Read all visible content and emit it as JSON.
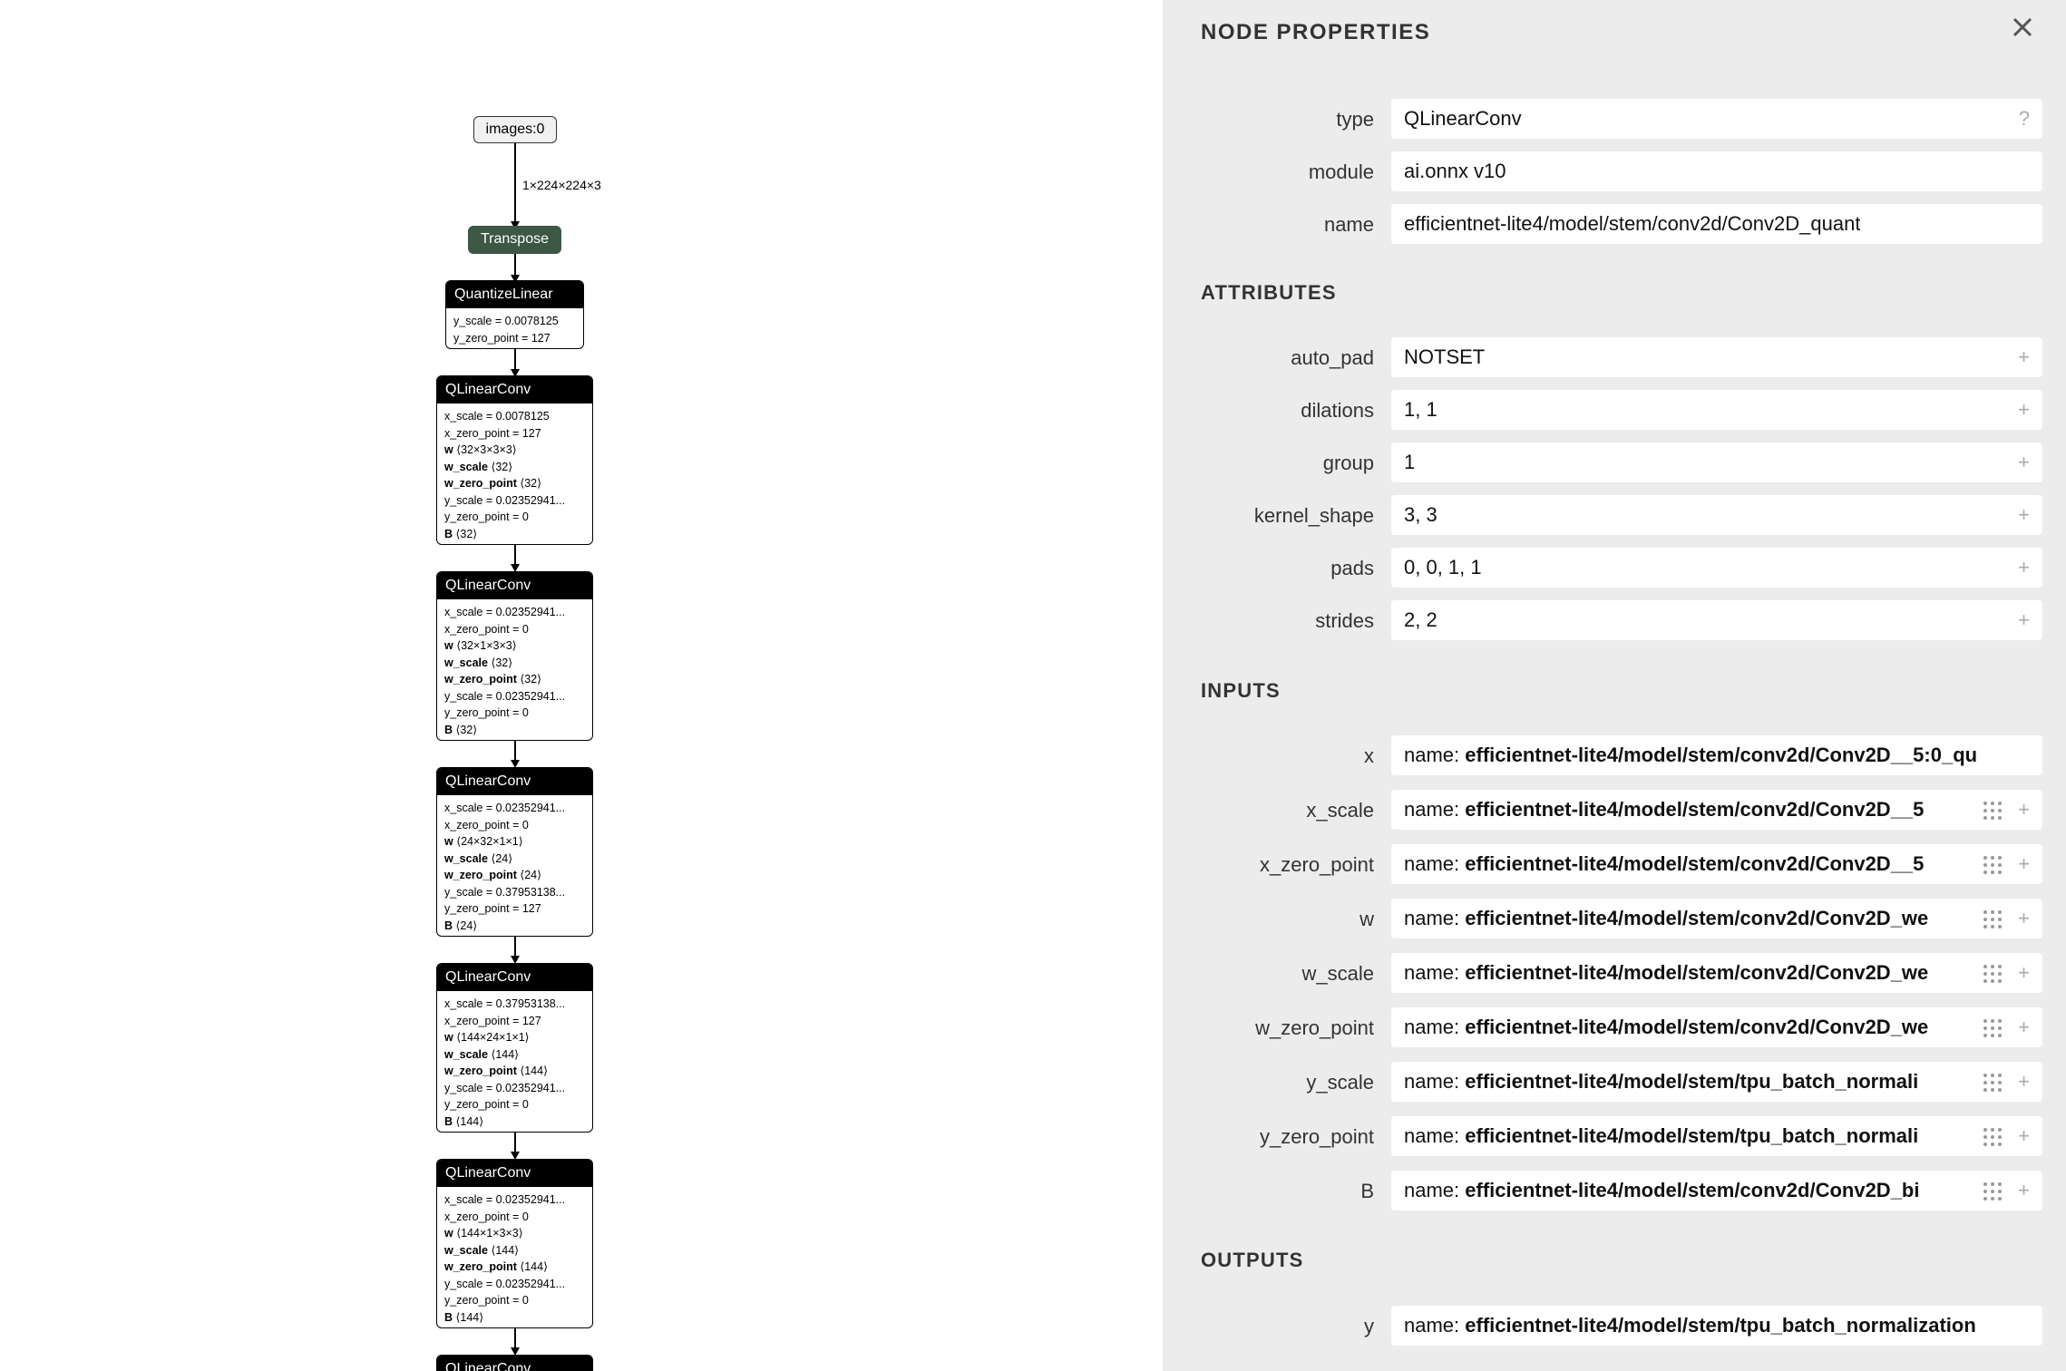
{
  "graph": {
    "input_node": "images:0",
    "input_edge_label": "1×224×224×3",
    "transpose_node": "Transpose",
    "quantize_node": {
      "title": "QuantizeLinear",
      "attrs": [
        {
          "k": "y_scale",
          "v": " = 0.0078125"
        },
        {
          "k": "y_zero_point",
          "v": " = 127"
        }
      ]
    },
    "conv_nodes": [
      {
        "title": "QLinearConv",
        "attrs": [
          {
            "k": "x_scale",
            "v": " = 0.0078125",
            "bold": false
          },
          {
            "k": "x_zero_point",
            "v": " = 127",
            "bold": false
          },
          {
            "k": "w",
            "v": " ⟨32×3×3×3⟩",
            "bold": true
          },
          {
            "k": "w_scale",
            "v": " ⟨32⟩",
            "bold": true
          },
          {
            "k": "w_zero_point",
            "v": " ⟨32⟩",
            "bold": true
          },
          {
            "k": "y_scale",
            "v": " = 0.02352941...",
            "bold": false
          },
          {
            "k": "y_zero_point",
            "v": " = 0",
            "bold": false
          },
          {
            "k": "B",
            "v": " ⟨32⟩",
            "bold": true
          }
        ]
      },
      {
        "title": "QLinearConv",
        "attrs": [
          {
            "k": "x_scale",
            "v": " = 0.02352941...",
            "bold": false
          },
          {
            "k": "x_zero_point",
            "v": " = 0",
            "bold": false
          },
          {
            "k": "w",
            "v": " ⟨32×1×3×3⟩",
            "bold": true
          },
          {
            "k": "w_scale",
            "v": " ⟨32⟩",
            "bold": true
          },
          {
            "k": "w_zero_point",
            "v": " ⟨32⟩",
            "bold": true
          },
          {
            "k": "y_scale",
            "v": " = 0.02352941...",
            "bold": false
          },
          {
            "k": "y_zero_point",
            "v": " = 0",
            "bold": false
          },
          {
            "k": "B",
            "v": " ⟨32⟩",
            "bold": true
          }
        ]
      },
      {
        "title": "QLinearConv",
        "attrs": [
          {
            "k": "x_scale",
            "v": " = 0.02352941...",
            "bold": false
          },
          {
            "k": "x_zero_point",
            "v": " = 0",
            "bold": false
          },
          {
            "k": "w",
            "v": " ⟨24×32×1×1⟩",
            "bold": true
          },
          {
            "k": "w_scale",
            "v": " ⟨24⟩",
            "bold": true
          },
          {
            "k": "w_zero_point",
            "v": " ⟨24⟩",
            "bold": true
          },
          {
            "k": "y_scale",
            "v": " = 0.37953138...",
            "bold": false
          },
          {
            "k": "y_zero_point",
            "v": " = 127",
            "bold": false
          },
          {
            "k": "B",
            "v": " ⟨24⟩",
            "bold": true
          }
        ]
      },
      {
        "title": "QLinearConv",
        "attrs": [
          {
            "k": "x_scale",
            "v": " = 0.37953138...",
            "bold": false
          },
          {
            "k": "x_zero_point",
            "v": " = 127",
            "bold": false
          },
          {
            "k": "w",
            "v": " ⟨144×24×1×1⟩",
            "bold": true
          },
          {
            "k": "w_scale",
            "v": " ⟨144⟩",
            "bold": true
          },
          {
            "k": "w_zero_point",
            "v": " ⟨144⟩",
            "bold": true
          },
          {
            "k": "y_scale",
            "v": " = 0.02352941...",
            "bold": false
          },
          {
            "k": "y_zero_point",
            "v": " = 0",
            "bold": false
          },
          {
            "k": "B",
            "v": " ⟨144⟩",
            "bold": true
          }
        ]
      },
      {
        "title": "QLinearConv",
        "attrs": [
          {
            "k": "x_scale",
            "v": " = 0.02352941...",
            "bold": false
          },
          {
            "k": "x_zero_point",
            "v": " = 0",
            "bold": false
          },
          {
            "k": "w",
            "v": " ⟨144×1×3×3⟩",
            "bold": true
          },
          {
            "k": "w_scale",
            "v": " ⟨144⟩",
            "bold": true
          },
          {
            "k": "w_zero_point",
            "v": " ⟨144⟩",
            "bold": true
          },
          {
            "k": "y_scale",
            "v": " = 0.02352941...",
            "bold": false
          },
          {
            "k": "y_zero_point",
            "v": " = 0",
            "bold": false
          },
          {
            "k": "B",
            "v": " ⟨144⟩",
            "bold": true
          }
        ]
      },
      {
        "title": "QLinearConv",
        "attrs": []
      }
    ]
  },
  "panel": {
    "title": "NODE PROPERTIES",
    "close_icon": "close-icon",
    "node_props": [
      {
        "label": "type",
        "value": "QLinearConv",
        "button": "?"
      },
      {
        "label": "module",
        "value": "ai.onnx v10",
        "button": ""
      },
      {
        "label": "name",
        "value": "efficientnet-lite4/model/stem/conv2d/Conv2D_quant",
        "button": ""
      }
    ],
    "attributes_title": "ATTRIBUTES",
    "attributes": [
      {
        "label": "auto_pad",
        "value": "NOTSET",
        "button": "+"
      },
      {
        "label": "dilations",
        "value": "1, 1",
        "button": "+"
      },
      {
        "label": "group",
        "value": "1",
        "button": "+"
      },
      {
        "label": "kernel_shape",
        "value": "3, 3",
        "button": "+"
      },
      {
        "label": "pads",
        "value": "0, 0, 1, 1",
        "button": "+"
      },
      {
        "label": "strides",
        "value": "2, 2",
        "button": "+"
      }
    ],
    "inputs_title": "INPUTS",
    "inputs": [
      {
        "label": "x",
        "prefix": "name: ",
        "value": "efficientnet-lite4/model/stem/conv2d/Conv2D__5:0_qu",
        "button": "",
        "grid": false
      },
      {
        "label": "x_scale",
        "prefix": "name: ",
        "value": "efficientnet-lite4/model/stem/conv2d/Conv2D__5",
        "button": "+",
        "grid": true
      },
      {
        "label": "x_zero_point",
        "prefix": "name: ",
        "value": "efficientnet-lite4/model/stem/conv2d/Conv2D__5",
        "button": "+",
        "grid": true
      },
      {
        "label": "w",
        "prefix": "name: ",
        "value": "efficientnet-lite4/model/stem/conv2d/Conv2D_we",
        "button": "+",
        "grid": true
      },
      {
        "label": "w_scale",
        "prefix": "name: ",
        "value": "efficientnet-lite4/model/stem/conv2d/Conv2D_we",
        "button": "+",
        "grid": true
      },
      {
        "label": "w_zero_point",
        "prefix": "name: ",
        "value": "efficientnet-lite4/model/stem/conv2d/Conv2D_we",
        "button": "+",
        "grid": true
      },
      {
        "label": "y_scale",
        "prefix": "name: ",
        "value": "efficientnet-lite4/model/stem/tpu_batch_normali",
        "button": "+",
        "grid": true
      },
      {
        "label": "y_zero_point",
        "prefix": "name: ",
        "value": "efficientnet-lite4/model/stem/tpu_batch_normali",
        "button": "+",
        "grid": true
      },
      {
        "label": "B",
        "prefix": "name: ",
        "value": "efficientnet-lite4/model/stem/conv2d/Conv2D_bi",
        "button": "+",
        "grid": true
      }
    ],
    "outputs_title": "OUTPUTS",
    "outputs": [
      {
        "label": "y",
        "prefix": "name: ",
        "value": "efficientnet-lite4/model/stem/tpu_batch_normalization",
        "button": "",
        "grid": false
      }
    ]
  }
}
